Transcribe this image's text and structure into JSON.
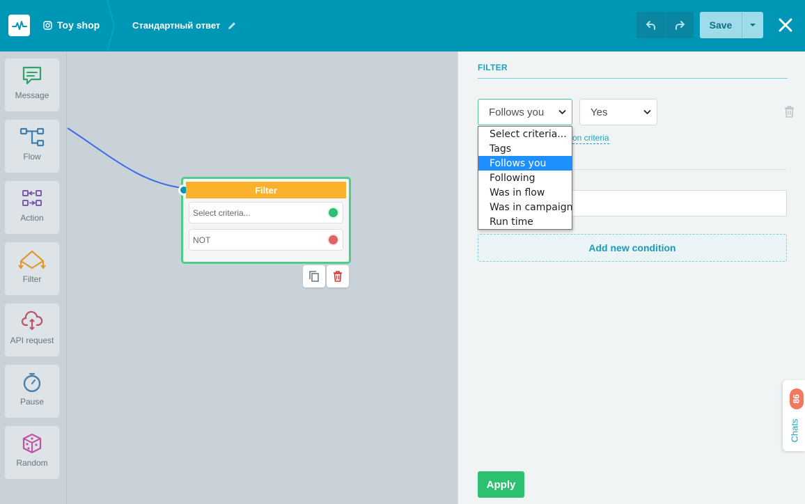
{
  "header": {
    "shop_name": "Toy shop",
    "flow_title": "Стандартный ответ",
    "save_label": "Save"
  },
  "toolbar": {
    "items": [
      {
        "label": "Message",
        "icon": "message-icon",
        "color": "#2fa36b"
      },
      {
        "label": "Flow",
        "icon": "flow-icon",
        "color": "#3f7fae"
      },
      {
        "label": "Action",
        "icon": "action-icon",
        "color": "#7b5ab0"
      },
      {
        "label": "Filter",
        "icon": "filter-icon",
        "color": "#e0992b"
      },
      {
        "label": "API request",
        "icon": "api-request-icon",
        "color": "#c0506a"
      },
      {
        "label": "Pause",
        "icon": "pause-icon",
        "color": "#4f7fa8"
      },
      {
        "label": "Random",
        "icon": "random-icon",
        "color": "#c052a6"
      }
    ]
  },
  "canvas": {
    "node": {
      "title": "Filter",
      "row1": "Select criteria...",
      "row2": "NOT"
    }
  },
  "panel": {
    "title": "FILTER",
    "criteria_value": "Follows you",
    "condition_value": "Yes",
    "dropdown_options": [
      "Select criteria...",
      "Tags",
      "Follows you",
      "Following",
      "Was in flow",
      "Was in campaign",
      "Run time"
    ],
    "selected_option_index": 2,
    "link_partial": "on criteria",
    "add_condition_label": "Add new condition",
    "apply_label": "Apply"
  },
  "chats_widget": {
    "badge": "86",
    "label": "Chats"
  },
  "colors": {
    "header_bg": "#0097b7",
    "accent": "#1aa3bf",
    "filter_orange": "#fbb12c",
    "node_border": "#50cc89",
    "apply_green": "#2fbf71"
  }
}
